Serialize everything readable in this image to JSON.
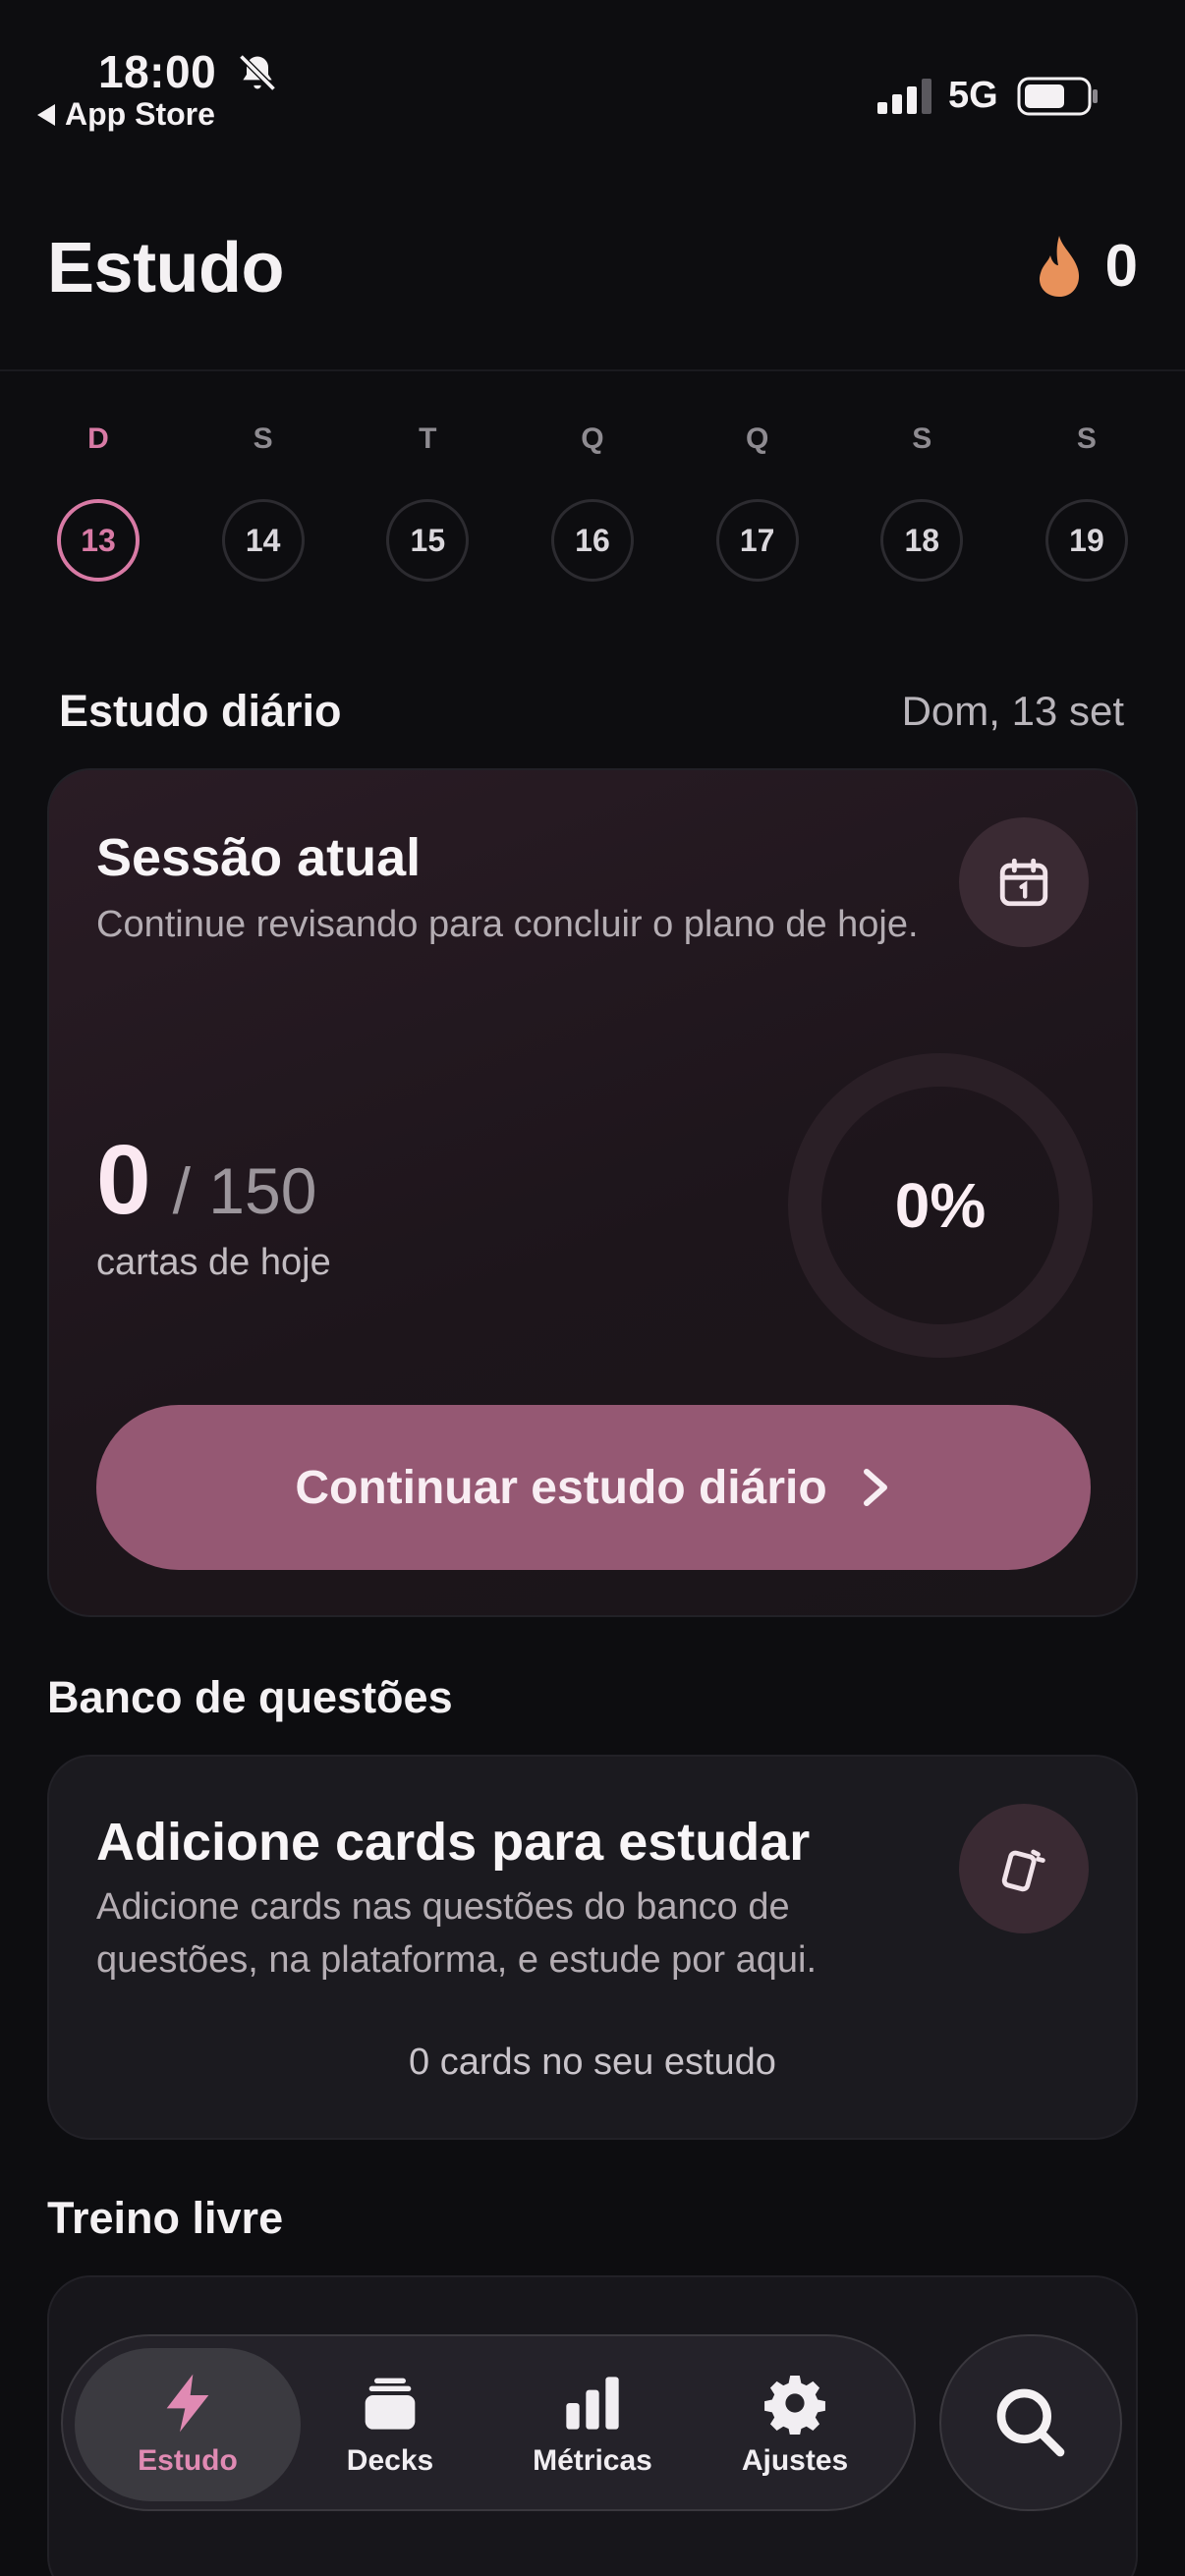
{
  "status_bar": {
    "time": "18:00",
    "back_label": "App Store",
    "network": "5G",
    "icons": [
      "bell-slash-icon",
      "signal-icon",
      "battery-icon"
    ]
  },
  "header": {
    "title": "Estudo",
    "streak_count": "0",
    "streak_icon": "flame-icon"
  },
  "week": {
    "days": [
      {
        "letter": "D",
        "date": "13",
        "active": true
      },
      {
        "letter": "S",
        "date": "14",
        "active": false
      },
      {
        "letter": "T",
        "date": "15",
        "active": false
      },
      {
        "letter": "Q",
        "date": "16",
        "active": false
      },
      {
        "letter": "Q",
        "date": "17",
        "active": false
      },
      {
        "letter": "S",
        "date": "18",
        "active": false
      },
      {
        "letter": "S",
        "date": "19",
        "active": false
      }
    ]
  },
  "daily": {
    "section_title": "Estudo diário",
    "date_label": "Dom, 13 set",
    "card_title": "Sessão atual",
    "card_desc": "Continue revisando para concluir o plano de hoje.",
    "count": "0",
    "total": "/ 150",
    "caption": "cartas de hoje",
    "percent": "0%",
    "progress": 0,
    "cta_label": "Continuar estudo diário",
    "icon": "calendar-icon"
  },
  "bank": {
    "section_title": "Banco de questões",
    "card_title": "Adicione cards para estudar",
    "card_desc": "Adicione cards nas questões do banco de questões, na plataforma, e estude por aqui.",
    "footer": "0 cards no seu estudo",
    "icon": "cards-icon"
  },
  "free": {
    "section_title": "Treino livre"
  },
  "tabbar": {
    "tabs": [
      {
        "label": "Estudo",
        "icon": "bolt-icon",
        "active": true
      },
      {
        "label": "Decks",
        "icon": "stack-icon",
        "active": false
      },
      {
        "label": "Métricas",
        "icon": "bar-chart-icon",
        "active": false
      },
      {
        "label": "Ajustes",
        "icon": "gear-icon",
        "active": false
      }
    ],
    "search_icon": "search-icon"
  },
  "colors": {
    "accent": "#d87aa5",
    "cta": "#955873",
    "background": "#0d0d10",
    "flame": "#e8915a"
  }
}
